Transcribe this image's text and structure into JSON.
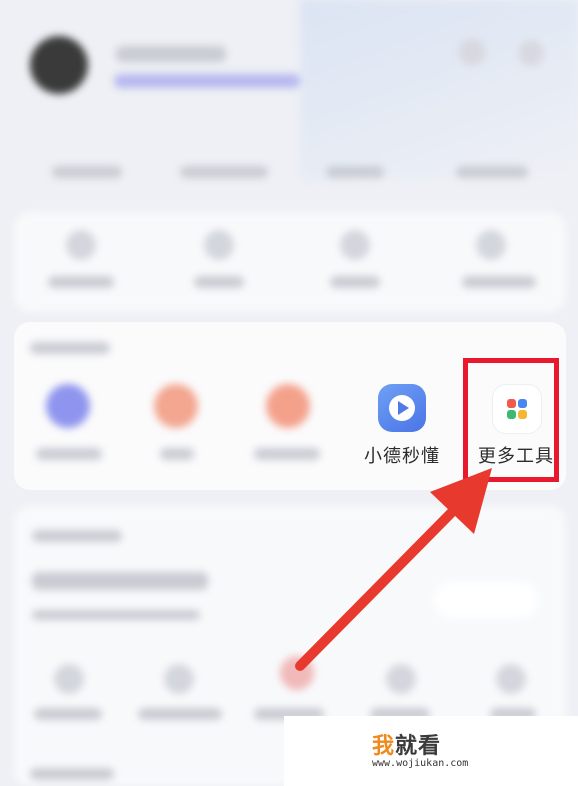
{
  "tools": {
    "xiaode": {
      "label": "小德秒懂",
      "icon": "play-icon"
    },
    "more": {
      "label": "更多工具",
      "icon": "grid-icon"
    }
  },
  "colors": {
    "highlight": "#e8192c",
    "arrow": "#e8392f",
    "xiaode_icon": "#5a86ee"
  },
  "watermark": {
    "title_main": "我",
    "title_rest": "就看",
    "url": "www.wojiukan.com"
  }
}
